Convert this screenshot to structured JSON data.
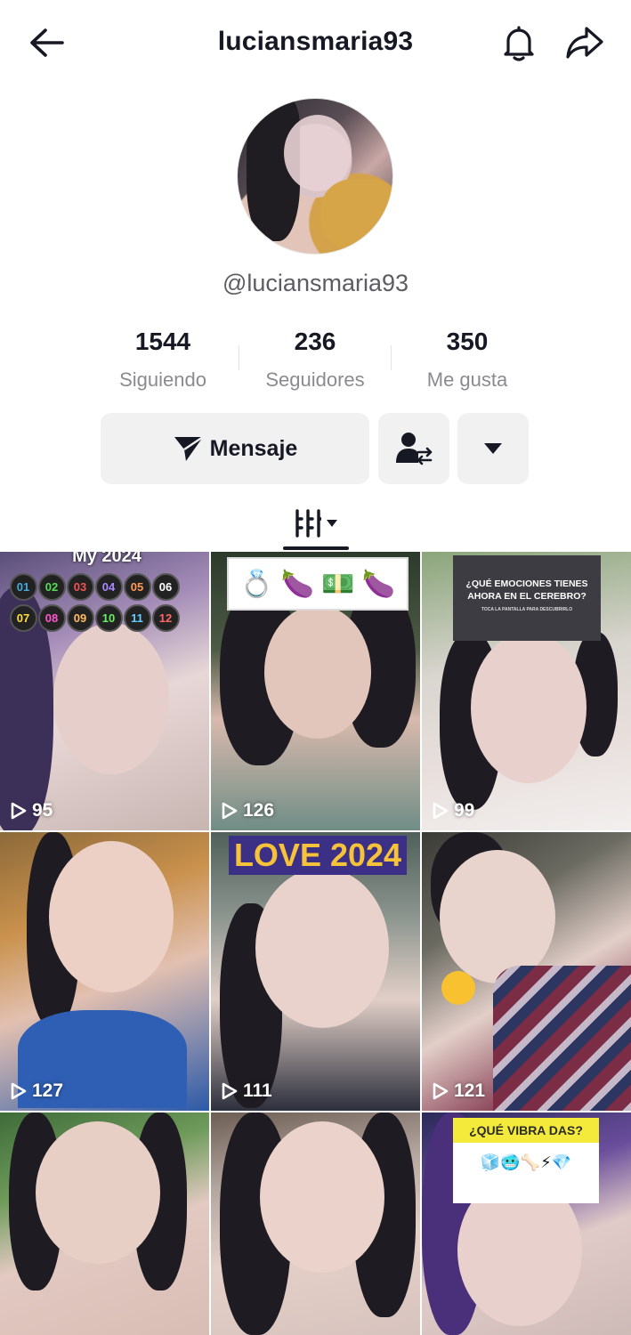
{
  "header": {
    "title": "luciansmaria93",
    "back_icon": "arrow-left-icon",
    "bell_icon": "bell-icon",
    "share_icon": "share-icon"
  },
  "profile": {
    "handle": "@luciansmaria93",
    "stats": [
      {
        "value": "1544",
        "label": "Siguiendo"
      },
      {
        "value": "236",
        "label": "Seguidores"
      },
      {
        "value": "350",
        "label": "Me gusta"
      }
    ]
  },
  "actions": {
    "message_label": "Mensaje",
    "message_icon": "send-icon",
    "friend_icon": "user-swap-icon",
    "more_icon": "caret-down-icon"
  },
  "tabs": {
    "grid_icon": "videos-grid-icon"
  },
  "videos": [
    {
      "views": "95",
      "overlay_title": "My 2024",
      "numbers": [
        "01",
        "02",
        "03",
        "04",
        "05",
        "06",
        "07",
        "08",
        "09",
        "10",
        "11",
        "12"
      ]
    },
    {
      "views": "126",
      "emoji_text": "💍 🍆 💵 🍆"
    },
    {
      "views": "99",
      "overlay_line1": "¿QUÉ EMOCIONES TIENES",
      "overlay_line2": "AHORA EN EL CEREBRO?",
      "overlay_small": "TOCA LA PANTALLA PARA DESCUBRIRLO"
    },
    {
      "views": "127"
    },
    {
      "views": "111",
      "overlay_title": "LOVE 2024"
    },
    {
      "views": "121"
    },
    {
      "views": ""
    },
    {
      "views": ""
    },
    {
      "views": "",
      "overlay_title": "¿QUÉ VIBRA DAS?",
      "emoji_text": "🧊🥶🦴⚡💎"
    }
  ],
  "colors": {
    "text": "#161823",
    "secondary": "#8a8b91",
    "button_bg": "#f1f1f2"
  }
}
